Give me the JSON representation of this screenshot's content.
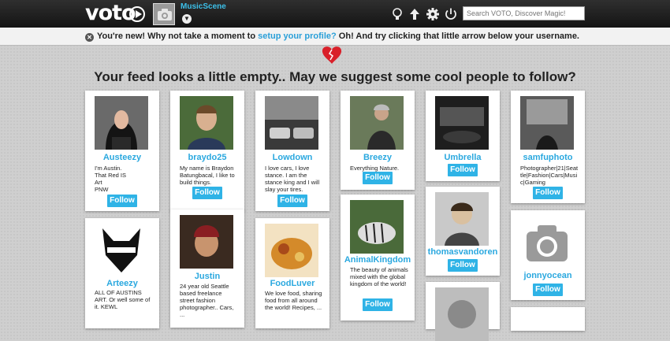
{
  "app": {
    "logo_text": "voto",
    "username": "MusicScene",
    "search_placeholder": "Search VOTO, Discover Magic!",
    "icons": [
      "lightbulb-icon",
      "upload-arrow-icon",
      "gear-icon",
      "power-icon"
    ]
  },
  "notice": {
    "part1": "You're new! Why not take a moment to ",
    "link": "setup your profile?",
    "part2": " Oh! And try clicking that little arrow below your username."
  },
  "feed": {
    "headline": "Your feed looks a little empty.. May we suggest some cool people to follow?"
  },
  "follow_label": "Follow",
  "cards": [
    {
      "name": "Austeezy",
      "bio": "I'm Austin.\nThat Red IS\nArt\nPNW"
    },
    {
      "name": "braydo25",
      "bio": "My name is Braydon Batungbacal, I like to build things."
    },
    {
      "name": "Lowdown",
      "bio": "I love cars, I love stance. I am the stance king and I will slay your tires."
    },
    {
      "name": "Breezy",
      "bio": "Everything Nature."
    },
    {
      "name": "Umbrella",
      "bio": ""
    },
    {
      "name": "samfuphoto",
      "bio": "Photographer|21|Seattle|Fashion|Cars|Music|Gaming"
    },
    {
      "name": "Arteezy",
      "bio": "ALL OF AUSTINS ART. Or well some of it. KEWL"
    },
    {
      "name": "Justin",
      "bio": "24 year old Seattle based freelance street fashion photographer.. Cars, ..."
    },
    {
      "name": "FoodLuver",
      "bio": "We love food, sharing food from all around the world! Recipes, ..."
    },
    {
      "name": "AnimalKingdom",
      "bio": "The beauty of animals mixed with the global kingdom of the world!"
    },
    {
      "name": "thomasvandoren",
      "bio": ""
    },
    {
      "name": "jonnyocean",
      "bio": ""
    }
  ]
}
